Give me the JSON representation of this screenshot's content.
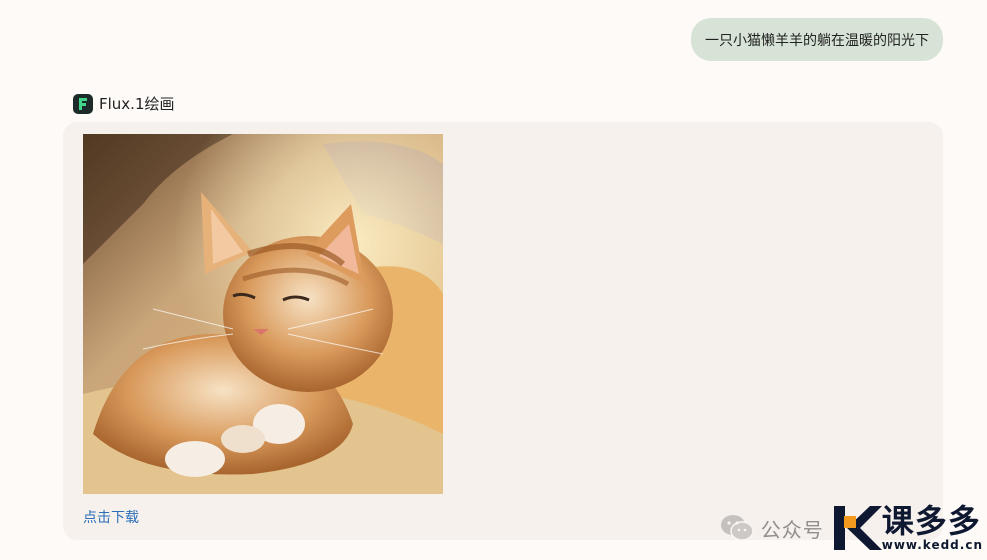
{
  "user_message": {
    "text": "一只小猫懒羊羊的躺在温暖的阳光下"
  },
  "bot": {
    "name": "Flux.1绘画",
    "avatar_icon": "flux-logo-icon"
  },
  "reply": {
    "download_label": "点击下载"
  },
  "watermark": {
    "account": "公众号",
    "brand": "课多多",
    "url": "www.kedd.cn"
  },
  "colors": {
    "user_bubble": "#d6e3d6",
    "card": "#f7f1ee",
    "link": "#2a6fb8",
    "brand_orange": "#f39a1e"
  }
}
